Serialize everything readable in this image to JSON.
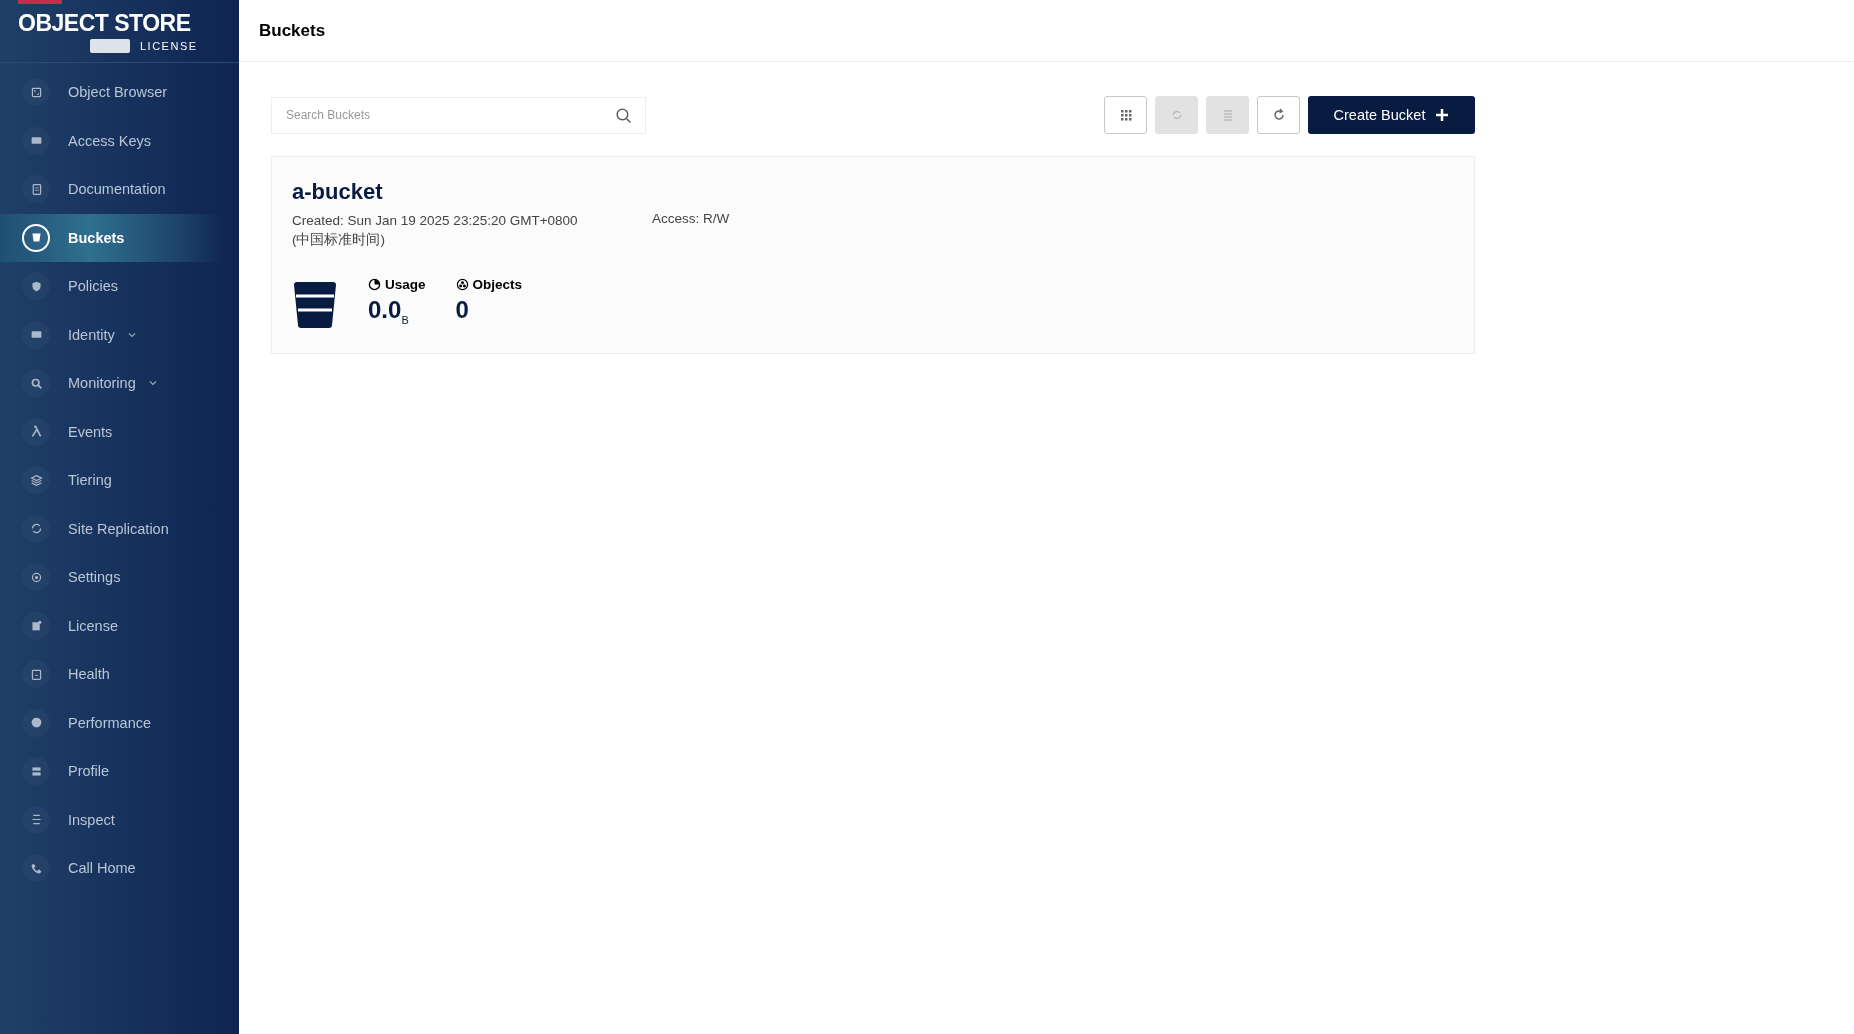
{
  "sidebar": {
    "logo": {
      "title": "OBJECT STORE",
      "license": "LICENSE"
    },
    "items": [
      {
        "label": "Object Browser",
        "kind": "link",
        "selected": false
      },
      {
        "label": "Access Keys",
        "kind": "link",
        "selected": false
      },
      {
        "label": "Documentation",
        "kind": "link",
        "selected": false
      },
      {
        "label": "Buckets",
        "kind": "link",
        "selected": true
      },
      {
        "label": "Policies",
        "kind": "link",
        "selected": false
      },
      {
        "label": "Identity",
        "kind": "group",
        "selected": false
      },
      {
        "label": "Monitoring",
        "kind": "group",
        "selected": false
      },
      {
        "label": "Events",
        "kind": "link",
        "selected": false
      },
      {
        "label": "Tiering",
        "kind": "link",
        "selected": false
      },
      {
        "label": "Site Replication",
        "kind": "link",
        "selected": false
      },
      {
        "label": "Settings",
        "kind": "link",
        "selected": false
      },
      {
        "label": "License",
        "kind": "link",
        "selected": false
      },
      {
        "label": "Health",
        "kind": "link",
        "selected": false
      },
      {
        "label": "Performance",
        "kind": "link",
        "selected": false
      },
      {
        "label": "Profile",
        "kind": "link",
        "selected": false
      },
      {
        "label": "Inspect",
        "kind": "link",
        "selected": false
      },
      {
        "label": "Call Home",
        "kind": "link",
        "selected": false
      }
    ]
  },
  "header": {
    "title": "Buckets"
  },
  "search": {
    "placeholder": "Search Buckets"
  },
  "toolbar": {
    "icon_buttons": [
      {
        "disabled": false
      },
      {
        "disabled": true
      },
      {
        "disabled": true
      },
      {
        "disabled": false
      }
    ],
    "create_button": "Create Bucket"
  },
  "buckets": [
    {
      "name": "a-bucket",
      "created": "Created: Sun Jan 19 2025 23:25:20 GMT+0800 (中国标准时间)",
      "access": "Access: R/W",
      "usage_label": "Usage",
      "usage": "0.0$_{B}$",
      "objects_label": "Objects",
      "objects": "0"
    }
  ]
}
